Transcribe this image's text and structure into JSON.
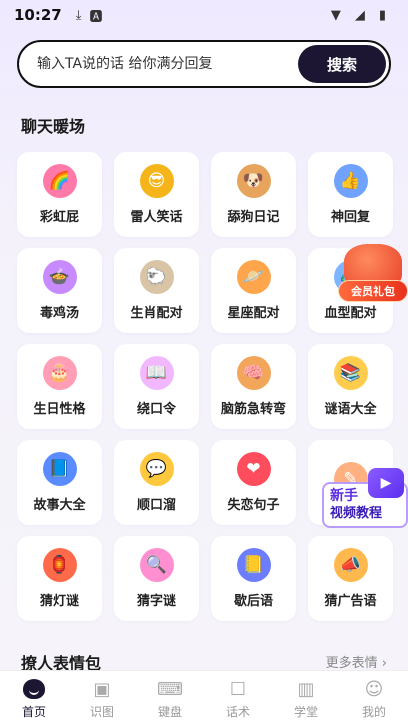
{
  "status_bar": {
    "time": "10:27",
    "left_icons": [
      "download-icon",
      "a-icon"
    ],
    "right_icons": [
      "wifi-icon",
      "signal-icon",
      "battery-icon"
    ]
  },
  "search": {
    "placeholder": "输入TA说的话 给你满分回复",
    "button_label": "搜索"
  },
  "sections": {
    "chat_warmup": "聊天暖场",
    "stickers": "撩人表情包",
    "more_stickers": "更多表情 ›"
  },
  "grid_items": [
    {
      "label": "彩虹屁",
      "icon": "rainbow-icon",
      "glyph": "🌈",
      "color": "#ff7aa8"
    },
    {
      "label": "雷人笑话",
      "icon": "sunglasses-emoji-icon",
      "glyph": "😎",
      "color": "#f4b41a"
    },
    {
      "label": "舔狗日记",
      "icon": "dog-icon",
      "glyph": "🐶",
      "color": "#e7a45c"
    },
    {
      "label": "神回复",
      "icon": "thumbs-up-chat-icon",
      "glyph": "👍",
      "color": "#6fa3ff"
    },
    {
      "label": "毒鸡汤",
      "icon": "soup-bowl-icon",
      "glyph": "🍲",
      "color": "#c88bff"
    },
    {
      "label": "生肖配对",
      "icon": "sheep-icon",
      "glyph": "🐑",
      "color": "#d9c4a5"
    },
    {
      "label": "星座配对",
      "icon": "planet-icon",
      "glyph": "🪐",
      "color": "#ffa64d"
    },
    {
      "label": "血型配对",
      "icon": "molecule-icon",
      "glyph": "🧬",
      "color": "#7fb5ff"
    },
    {
      "label": "生日性格",
      "icon": "birthday-cake-icon",
      "glyph": "🎂",
      "color": "#ff9eb4"
    },
    {
      "label": "绕口令",
      "icon": "open-book-icon",
      "glyph": "📖",
      "color": "#f2b8ff"
    },
    {
      "label": "脑筋急转弯",
      "icon": "brain-icon",
      "glyph": "🧠",
      "color": "#f2a65a"
    },
    {
      "label": "谜语大全",
      "icon": "books-icon",
      "glyph": "📚",
      "color": "#ffcc4d"
    },
    {
      "label": "故事大全",
      "icon": "storybook-icon",
      "glyph": "📘",
      "color": "#5b8cff"
    },
    {
      "label": "顺口溜",
      "icon": "chat-bubble-icon",
      "glyph": "💬",
      "color": "#ffc83d"
    },
    {
      "label": "失恋句子",
      "icon": "heart-icon",
      "glyph": "❤",
      "color": "#ff4d5e"
    },
    {
      "label": "",
      "icon": "megaphone-doodle-icon",
      "glyph": "✎",
      "color": "#ffb080"
    },
    {
      "label": "猜灯谜",
      "icon": "lantern-icon",
      "glyph": "🏮",
      "color": "#ff6b4a"
    },
    {
      "label": "猜字谜",
      "icon": "magnifier-icon",
      "glyph": "🔍",
      "color": "#ff8fd0"
    },
    {
      "label": "歇后语",
      "icon": "notebook-icon",
      "glyph": "📒",
      "color": "#6c7dff"
    },
    {
      "label": "猜广告语",
      "icon": "megaphone-icon",
      "glyph": "📣",
      "color": "#ffb84d"
    }
  ],
  "floating": {
    "gift_label": "会员礼包",
    "tutorial_line1": "新手",
    "tutorial_line2": "视频教程"
  },
  "tabbar": [
    {
      "label": "首页",
      "icon": "home-icon",
      "active": true
    },
    {
      "label": "识图",
      "icon": "image-recognition-icon",
      "active": false
    },
    {
      "label": "键盘",
      "icon": "keyboard-icon",
      "active": false
    },
    {
      "label": "话术",
      "icon": "chat-script-icon",
      "active": false
    },
    {
      "label": "学堂",
      "icon": "book-icon",
      "active": false
    },
    {
      "label": "我的",
      "icon": "profile-icon",
      "active": false
    }
  ]
}
